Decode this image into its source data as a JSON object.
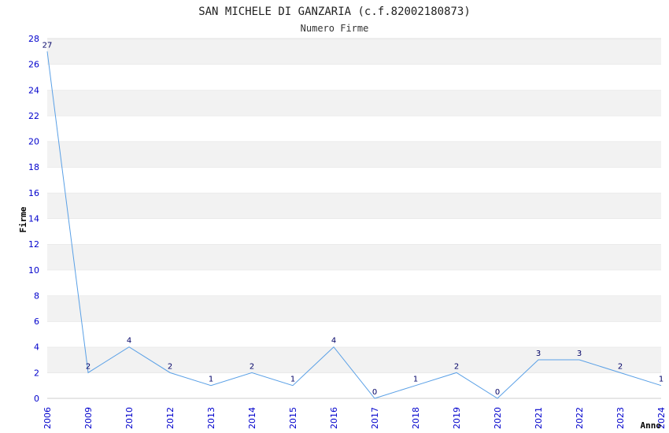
{
  "chart_data": {
    "type": "line",
    "title": "SAN MICHELE DI GANZARIA (c.f.82002180873)",
    "subtitle": "Numero Firme",
    "xlabel": "Anno",
    "ylabel": "Firme",
    "categories": [
      "2006",
      "2009",
      "2010",
      "2012",
      "2013",
      "2014",
      "2015",
      "2016",
      "2017",
      "2018",
      "2019",
      "2020",
      "2021",
      "2022",
      "2023",
      "2024"
    ],
    "series": [
      {
        "values": [
          27,
          2,
          4,
          2,
          1,
          2,
          1,
          4,
          0,
          1,
          2,
          0,
          3,
          3,
          2,
          1
        ]
      }
    ],
    "ylim": [
      0,
      28
    ],
    "yticks": [
      0,
      2,
      4,
      6,
      8,
      10,
      12,
      14,
      16,
      18,
      20,
      22,
      24,
      26,
      28
    ],
    "grid": true,
    "colors": {
      "line": "#5aa0e6",
      "band": "#f2f2f2",
      "tick": "#0000cc",
      "label": "#000066"
    }
  }
}
